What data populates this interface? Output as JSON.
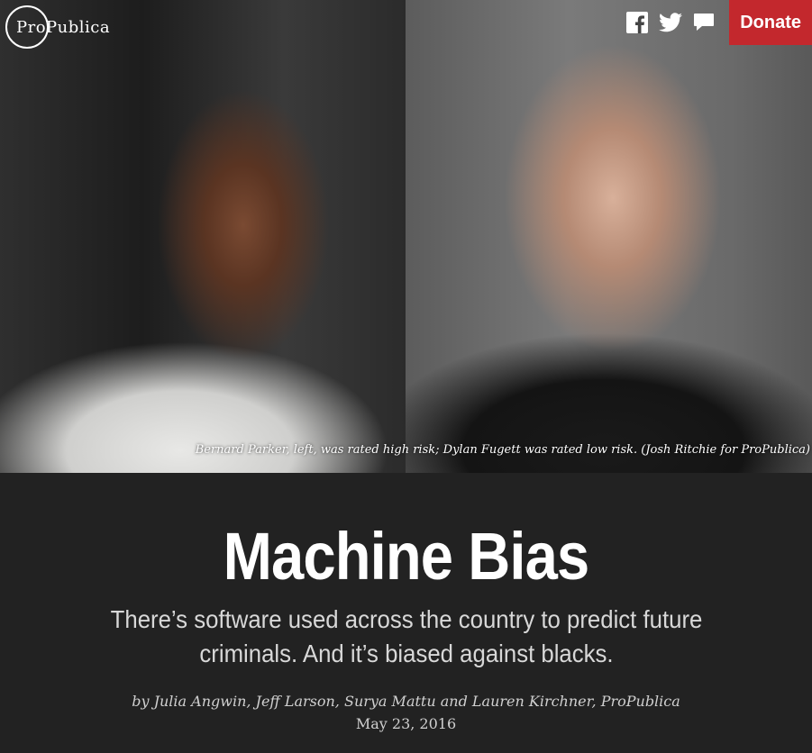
{
  "header": {
    "logo_text": "ProPublica",
    "social": [
      "facebook-icon",
      "twitter-icon",
      "comment-icon"
    ],
    "donate_label": "Donate"
  },
  "hero": {
    "caption": "Bernard Parker, left, was rated high risk; Dylan Fugett was rated low risk. (Josh Ritchie for ProPublica)"
  },
  "article": {
    "title": "Machine Bias",
    "dek": "There’s software used across the country to predict future criminals. And it’s biased against blacks.",
    "byline": "by Julia Angwin, Jeff Larson, Surya Mattu and Lauren Kirchner, ProPublica",
    "date": "May 23, 2016"
  },
  "colors": {
    "background": "#222222",
    "donate": "#c3282d",
    "text": "#ffffff"
  }
}
